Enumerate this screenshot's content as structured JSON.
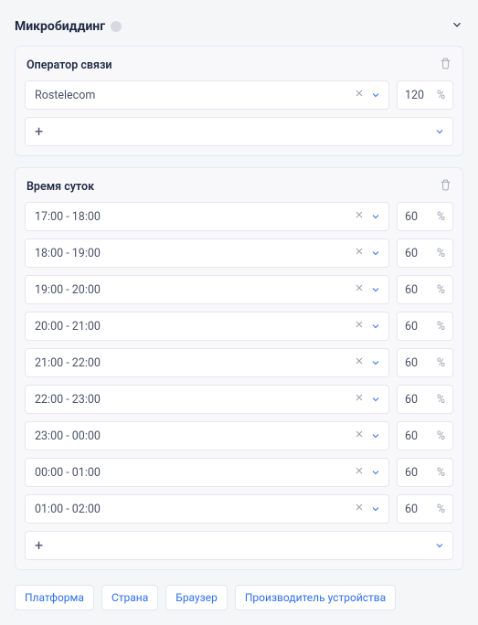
{
  "section": {
    "title": "Микробиддинг"
  },
  "groups": [
    {
      "title": "Оператор связи",
      "rows": [
        {
          "label": "Rostelecom",
          "value": "120",
          "unit": "%"
        }
      ]
    },
    {
      "title": "Время суток",
      "rows": [
        {
          "label": "17:00 - 18:00",
          "value": "60",
          "unit": "%"
        },
        {
          "label": "18:00 - 19:00",
          "value": "60",
          "unit": "%"
        },
        {
          "label": "19:00 - 20:00",
          "value": "60",
          "unit": "%"
        },
        {
          "label": "20:00 - 21:00",
          "value": "60",
          "unit": "%"
        },
        {
          "label": "21:00 - 22:00",
          "value": "60",
          "unit": "%"
        },
        {
          "label": "22:00 - 23:00",
          "value": "60",
          "unit": "%"
        },
        {
          "label": "23:00 - 00:00",
          "value": "60",
          "unit": "%"
        },
        {
          "label": "00:00 - 01:00",
          "value": "60",
          "unit": "%"
        },
        {
          "label": "01:00 - 02:00",
          "value": "60",
          "unit": "%"
        }
      ]
    }
  ],
  "chips": [
    {
      "label": "Платформа"
    },
    {
      "label": "Страна"
    },
    {
      "label": "Браузер"
    },
    {
      "label": "Производитель устройства"
    }
  ]
}
